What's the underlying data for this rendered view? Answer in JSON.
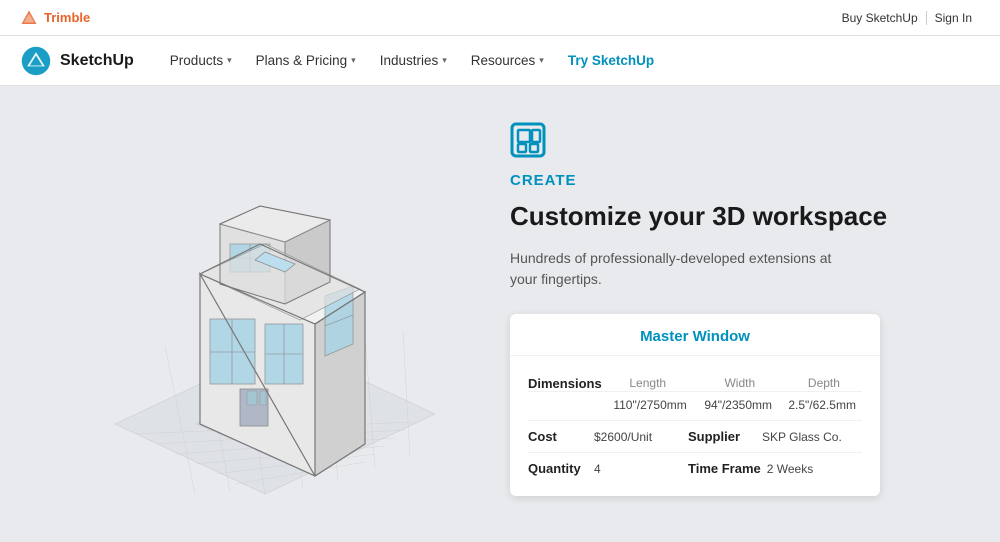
{
  "topBar": {
    "logo": "Trimble",
    "buyLink": "Buy SketchUp",
    "signInLink": "Sign In"
  },
  "nav": {
    "logo": "SketchUp",
    "items": [
      {
        "label": "Products",
        "hasDropdown": true
      },
      {
        "label": "Plans & Pricing",
        "hasDropdown": true
      },
      {
        "label": "Industries",
        "hasDropdown": true
      },
      {
        "label": "Resources",
        "hasDropdown": true
      }
    ],
    "cta": "Try SketchUp"
  },
  "hero": {
    "createLabel": "CREATE",
    "headline": "Customize your 3D workspace",
    "subtext": "Hundreds of professionally-developed extensions at your fingertips."
  },
  "card": {
    "title": "Master Window",
    "dimensionsLabel": "Dimensions",
    "lengthHeader": "Length",
    "widthHeader": "Width",
    "depthHeader": "Depth",
    "lengthValue": "110\"/2750mm",
    "widthValue": "94\"/2350mm",
    "depthValue": "2.5\"/62.5mm",
    "costLabel": "Cost",
    "costValue": "$2600/Unit",
    "supplierLabel": "Supplier",
    "supplierValue": "SKP Glass Co.",
    "quantityLabel": "Quantity",
    "quantityValue": "4",
    "timeFrameLabel": "Time Frame",
    "timeFrameValue": "2 Weeks"
  }
}
